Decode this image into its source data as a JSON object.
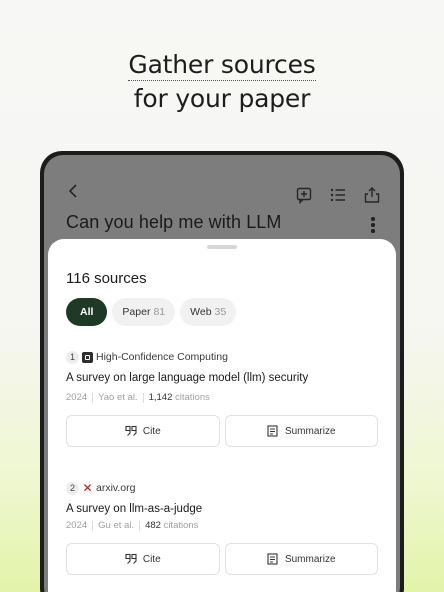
{
  "headline": {
    "line1": "Gather sources",
    "line2": "for your paper"
  },
  "chat": {
    "title": "Can you help me with LLM"
  },
  "sheet": {
    "title": "116 sources",
    "filters": [
      {
        "label": "All",
        "count": ""
      },
      {
        "label": "Paper",
        "count": "81"
      },
      {
        "label": "Web",
        "count": "35"
      }
    ]
  },
  "sources": [
    {
      "index": "1",
      "site": "High-Confidence Computing",
      "icon": "journal-icon",
      "title": "A survey on large language model (llm) security",
      "year": "2024",
      "authors": "Yao et al.",
      "citations": "1,142",
      "citations_label": "citations",
      "cite_label": "Cite",
      "summarize_label": "Summarize"
    },
    {
      "index": "2",
      "site": "arxiv.org",
      "icon": "arxiv-icon",
      "title": "A survey on llm-as-a-judge",
      "year": "2024",
      "authors": "Gu et al.",
      "citations": "482",
      "citations_label": "citations",
      "cite_label": "Cite",
      "summarize_label": "Summarize"
    }
  ],
  "colors": {
    "active_chip": "#1e3a26",
    "arxiv": "#b31b1b"
  }
}
